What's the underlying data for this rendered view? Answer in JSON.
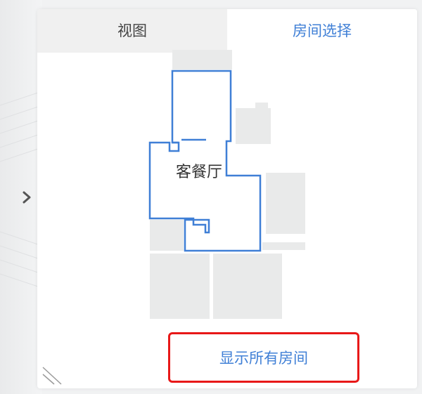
{
  "tabs": [
    {
      "label": "视图",
      "active": false
    },
    {
      "label": "房间选择",
      "active": true
    }
  ],
  "floorplan": {
    "selected_room_label": "客餐厅",
    "selected_outline_color": "#3f7fd6",
    "room_fill_color": "#e9eaea"
  },
  "show_all_button": {
    "label": "显示所有房间"
  },
  "highlight_color": "#e81818",
  "icons": {
    "expand": "chevron-right-icon",
    "resize": "resize-grip-icon"
  }
}
